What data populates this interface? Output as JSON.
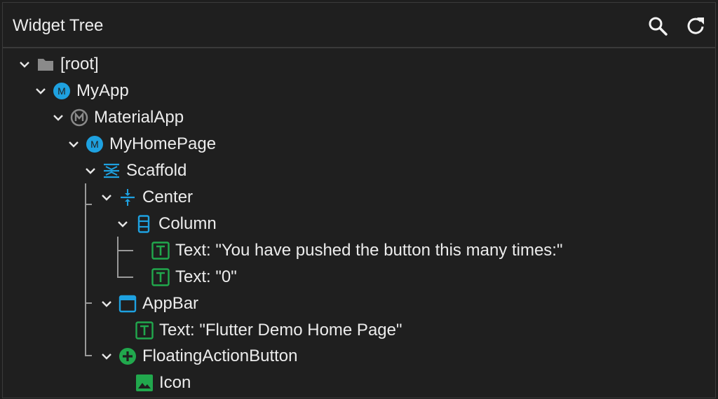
{
  "header": {
    "title": "Widget Tree",
    "search_icon": "search-icon",
    "refresh_icon": "refresh-icon"
  },
  "tree": {
    "nodes": [
      {
        "label": "[root]",
        "icon": "folder-icon",
        "expanded": true
      },
      {
        "label": "MyApp",
        "icon": "m-circle-icon",
        "expanded": true
      },
      {
        "label": "MaterialApp",
        "icon": "material-app-icon",
        "expanded": true
      },
      {
        "label": "MyHomePage",
        "icon": "m-circle-icon",
        "expanded": true
      },
      {
        "label": "Scaffold",
        "icon": "scaffold-icon",
        "expanded": true
      },
      {
        "label": "Center",
        "icon": "center-icon",
        "expanded": true
      },
      {
        "label": "Column",
        "icon": "column-icon",
        "expanded": true
      },
      {
        "label": "Text: \"You have pushed the button this many times:\"",
        "icon": "text-icon"
      },
      {
        "label": "Text: \"0\"",
        "icon": "text-icon"
      },
      {
        "label": "AppBar",
        "icon": "appbar-icon",
        "expanded": true
      },
      {
        "label": "Text: \"Flutter Demo Home Page\"",
        "icon": "text-icon"
      },
      {
        "label": "FloatingActionButton",
        "icon": "fab-icon",
        "expanded": true
      },
      {
        "label": "Icon",
        "icon": "image-icon"
      }
    ]
  },
  "colors": {
    "background": "#1f1f1f",
    "text": "#ececec",
    "blue": "#1ea1e0",
    "green": "#21a84d",
    "gray": "#8a8a8a"
  }
}
